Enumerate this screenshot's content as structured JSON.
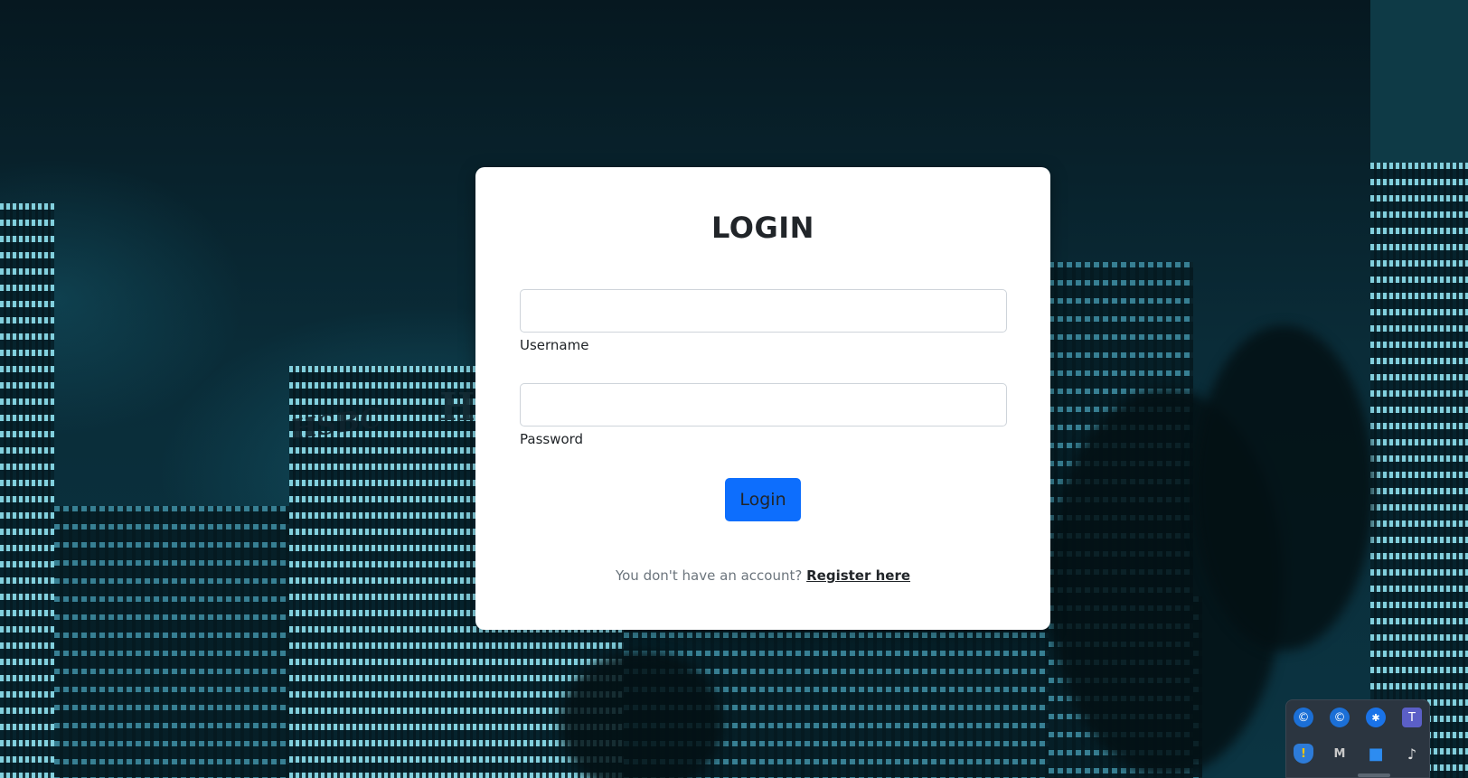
{
  "login": {
    "title": "LOGIN",
    "username_label": "Username",
    "username_value": "",
    "password_label": "Password",
    "password_value": "",
    "submit_label": "Login",
    "register_prompt": "You don't have an account?",
    "register_link": "Register here"
  },
  "background": {
    "building_sign": "HSBC",
    "building_letter": "H"
  },
  "colors": {
    "primary_button": "#0d6efd",
    "card_background": "#ffffff",
    "page_background": "#0a2c38",
    "tray_background": "#2b3540"
  },
  "tray": {
    "icons": [
      {
        "name": "edge-icon-1",
        "glyph": "©"
      },
      {
        "name": "edge-icon-2",
        "glyph": "©"
      },
      {
        "name": "bluetooth-icon",
        "glyph": "✱"
      },
      {
        "name": "teams-icon",
        "glyph": "T"
      },
      {
        "name": "defender-warning-icon",
        "glyph": "!"
      },
      {
        "name": "mcafee-icon",
        "glyph": "M"
      },
      {
        "name": "app-icon",
        "glyph": "■"
      },
      {
        "name": "volume-icon",
        "glyph": "♪"
      }
    ]
  }
}
